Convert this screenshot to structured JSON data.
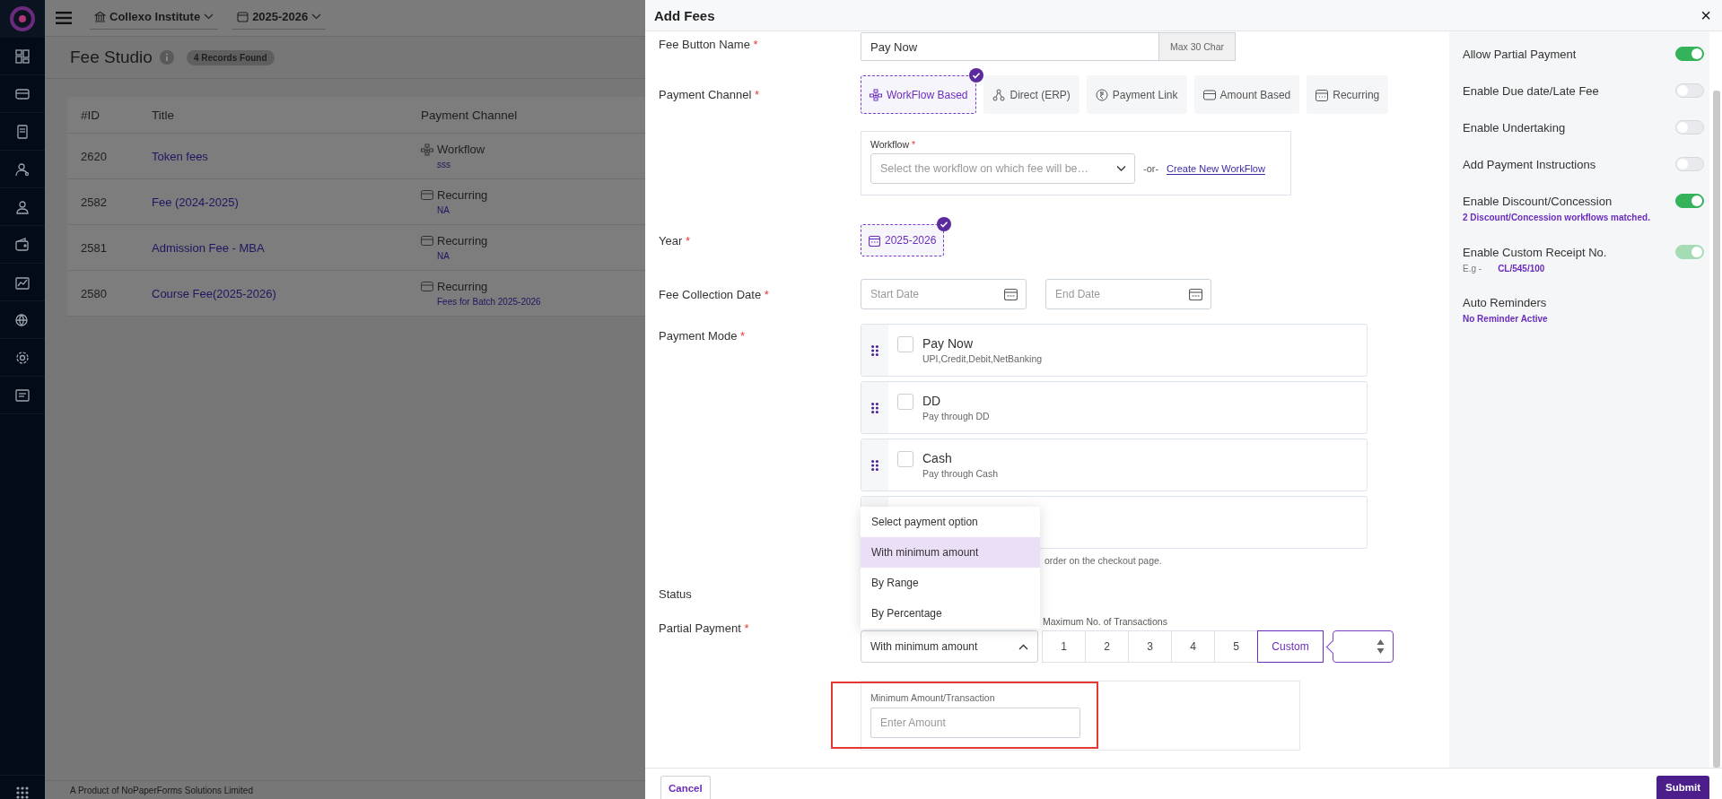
{
  "topbar": {
    "institute": "Collexo Institute",
    "year": "2025-2026"
  },
  "page": {
    "title": "Fee Studio",
    "record_count": "4 Records Found",
    "footer": "A Product of  NoPaperForms Solutions Limited"
  },
  "table": {
    "columns": [
      "#ID",
      "Title",
      "Payment Channel"
    ],
    "rows": [
      {
        "id": "2620",
        "title": "Token fees",
        "channel": {
          "kind": "workflow",
          "label": "Workflow",
          "detail": "sss"
        }
      },
      {
        "id": "2582",
        "title": "Fee (2024-2025)",
        "channel": {
          "kind": "recurring",
          "label": "Recurring",
          "detail": "NA"
        }
      },
      {
        "id": "2581",
        "title": "Admission Fee - MBA",
        "channel": {
          "kind": "recurring",
          "label": "Recurring",
          "detail": "NA"
        }
      },
      {
        "id": "2580",
        "title": "Course Fee(2025-2026)",
        "channel": {
          "kind": "recurring",
          "label": "Recurring",
          "detail": "Fees for Batch 2025-2026"
        }
      }
    ]
  },
  "dialog": {
    "title": "Add Fees",
    "close": "×",
    "fee_button_name": {
      "label": "Fee Button Name",
      "required_mark": "*",
      "value": "Pay Now",
      "addon": "Max 30 Char"
    },
    "payment_channel": {
      "label": "Payment Channel",
      "required_mark": "*",
      "options": [
        {
          "kind": "workflow",
          "label": "WorkFlow Based",
          "selected": true
        },
        {
          "kind": "direct",
          "label": "Direct (ERP)",
          "selected": false
        },
        {
          "kind": "link",
          "label": "Payment Link",
          "selected": false
        },
        {
          "kind": "amount",
          "label": "Amount Based",
          "selected": false
        },
        {
          "kind": "recurring",
          "label": "Recurring",
          "selected": false
        }
      ]
    },
    "workflow": {
      "label": "Workflow",
      "required_mark": "*",
      "placeholder": "Select the workflow on which fee will be…",
      "separator": "-or-",
      "link": "Create New WorkFlow"
    },
    "year": {
      "label": "Year",
      "required_mark": "*",
      "options": [
        {
          "label": "2025-2026",
          "selected": true
        }
      ]
    },
    "fee_collection_date": {
      "label": "Fee Collection Date",
      "required_mark": "*",
      "start": {
        "placeholder": "Start Date"
      },
      "end": {
        "placeholder": "End Date"
      }
    },
    "payment_mode": {
      "label": "Payment Mode",
      "required_mark": "*",
      "items": [
        {
          "title": "Pay Now",
          "subtitle": "UPI,Credit,Debit,NetBanking",
          "checked": false
        },
        {
          "title": "DD",
          "subtitle": "Pay through DD",
          "checked": false
        },
        {
          "title": "Cash",
          "subtitle": "Pay through Cash",
          "checked": false
        }
      ],
      "hint": "order on the checkout page."
    },
    "status": {
      "label": "Status"
    },
    "partial_payment": {
      "label": "Partial Payment",
      "required_mark": "*",
      "value": "With minimum amount",
      "expanded": true,
      "menu": [
        {
          "label": "Select payment option",
          "selected": false
        },
        {
          "label": "With minimum amount",
          "selected": true
        },
        {
          "label": "By Range",
          "selected": false
        },
        {
          "label": "By Percentage",
          "selected": false
        }
      ],
      "transactions_label": "Maximum No. of Transactions",
      "transactions": [
        {
          "label": "1",
          "selected": false
        },
        {
          "label": "2",
          "selected": false
        },
        {
          "label": "3",
          "selected": false
        },
        {
          "label": "4",
          "selected": false
        },
        {
          "label": "5",
          "selected": false
        },
        {
          "label": "Custom",
          "selected": true
        }
      ],
      "min_amount": {
        "label": "Minimum Amount/Transaction",
        "placeholder": "Enter Amount"
      }
    },
    "settings": [
      {
        "kind": "toggle",
        "label": "Allow Partial Payment",
        "on": true,
        "disabled": false
      },
      {
        "kind": "toggle",
        "label": "Enable Due date/Late Fee",
        "on": false,
        "disabled": false
      },
      {
        "kind": "toggle",
        "label": "Enable Undertaking",
        "on": false,
        "disabled": false
      },
      {
        "kind": "toggle",
        "label": "Add Payment Instructions",
        "on": false,
        "disabled": false
      },
      {
        "kind": "toggle",
        "label": "Enable Discount/Concession",
        "on": true,
        "disabled": false,
        "note": "2 Discount/Concession workflows matched."
      },
      {
        "kind": "toggle",
        "label": "Enable Custom Receipt No.",
        "on": true,
        "disabled": true,
        "example_label": "E.g -",
        "example": "CL/545/100"
      },
      {
        "kind": "info",
        "label": "Auto Reminders",
        "note": "No Reminder Active"
      }
    ],
    "cancel": "Cancel",
    "submit": "Submit"
  }
}
